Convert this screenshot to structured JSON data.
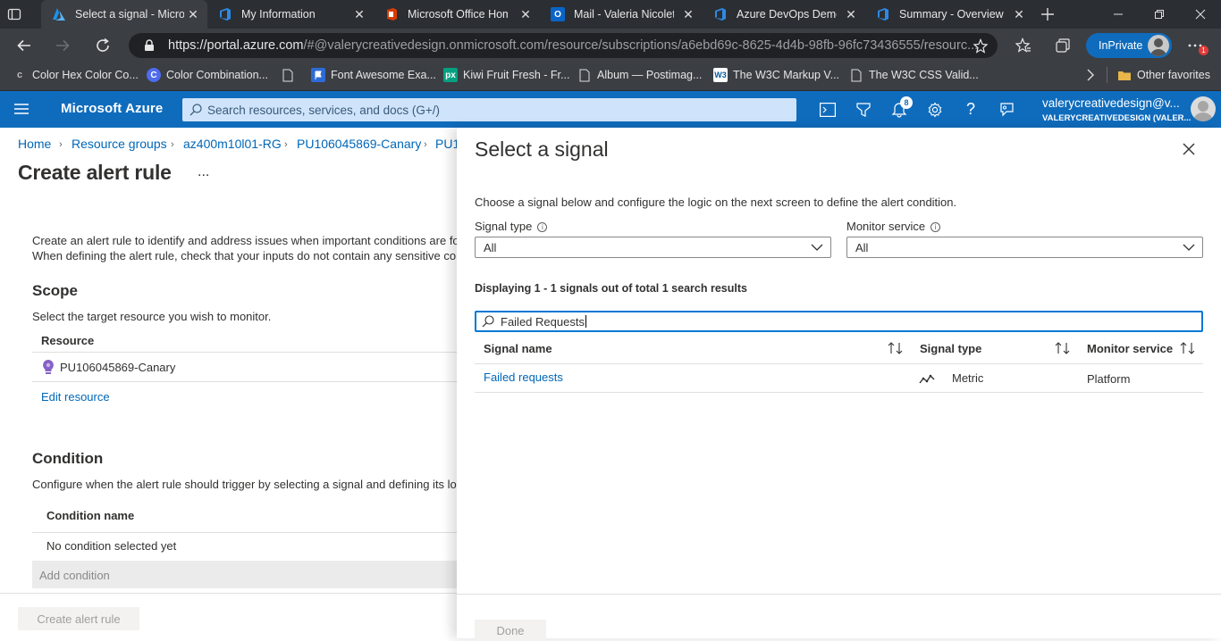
{
  "browser": {
    "tabs": [
      {
        "title": "Select a signal - Microsoft Azure",
        "icon": "azure-icon"
      },
      {
        "title": "My Information",
        "icon": "devops-icon"
      },
      {
        "title": "Microsoft Office Home",
        "icon": "office-icon"
      },
      {
        "title": "Mail - Valeria Nicoleta",
        "icon": "outlook-icon"
      },
      {
        "title": "Azure DevOps Demo Generator",
        "icon": "devops-icon"
      },
      {
        "title": "Summary - Overview",
        "icon": "devops-icon"
      }
    ],
    "url_main": "https://portal.azure.com",
    "url_rest": "/#@valerycreativedesign.onmicrosoft.com/resource/subscriptions/a6ebd69c-8625-4d4b-98fb-96fc73436555/resourc...",
    "inprivate_label": "InPrivate",
    "notification_badge": "1",
    "bookmarks": [
      {
        "label": "Color Hex Color Co...",
        "icon": "colorhex-icon"
      },
      {
        "label": "Color Combination...",
        "icon": "color-combination-icon"
      },
      {
        "label": "Font Awesome Exa...",
        "icon": "page-icon"
      },
      {
        "label": "Font Awesome Exa...",
        "icon": "flag-icon"
      },
      {
        "label": "Kiwi Fruit Fresh - Fr...",
        "icon": "pexels-icon"
      },
      {
        "label": "Album — Postimag...",
        "icon": "page-icon"
      },
      {
        "label": "The W3C Markup V...",
        "icon": "w3c-icon"
      },
      {
        "label": "The W3C CSS Valid...",
        "icon": "page-icon"
      }
    ],
    "other_favorites": "Other favorites"
  },
  "azure": {
    "brand": "Microsoft Azure",
    "search_placeholder": "Search resources, services, and docs (G+/)",
    "notifications_count": "8",
    "account_email": "valerycreativedesign@v...",
    "account_tenant": "VALERYCREATIVEDESIGN (VALER..."
  },
  "breadcrumb": [
    "Home",
    "Resource groups",
    "az400m10l01-RG",
    "PU106045869-Canary",
    "PU1"
  ],
  "page": {
    "title": "Create alert rule",
    "more": "...",
    "intro_line1": "Create an alert rule to identify and address issues when important conditions are fo",
    "intro_line2": "When defining the alert rule, check that your inputs do not contain any sensitive co",
    "scope_title": "Scope",
    "scope_desc": "Select the target resource you wish to monitor.",
    "resource_header": "Resource",
    "resource_name": "PU106045869-Canary",
    "edit_resource": "Edit resource",
    "condition_title": "Condition",
    "condition_desc": "Configure when the alert rule should trigger by selecting a signal and defining its lo",
    "condition_name_header": "Condition name",
    "no_condition": "No condition selected yet",
    "add_condition": "Add condition",
    "create_button": "Create alert rule"
  },
  "panel": {
    "title": "Select a signal",
    "description": "Choose a signal below and configure the logic on the next screen to define the alert condition.",
    "signal_type_label": "Signal type",
    "signal_type_value": "All",
    "monitor_service_label": "Monitor service",
    "monitor_service_value": "All",
    "results_text": "Displaying 1 - 1 signals out of total 1 search results",
    "search_value": "Failed Requests",
    "columns": [
      "Signal name",
      "Signal type",
      "Monitor service"
    ],
    "rows": [
      {
        "signal_name": "Failed requests",
        "signal_type": "Metric",
        "monitor_service": "Platform"
      }
    ],
    "done_button": "Done"
  },
  "colors": {
    "azure_blue": "#0f6cbd",
    "link": "#0067b8",
    "browser_dark": "#2b2e33"
  }
}
